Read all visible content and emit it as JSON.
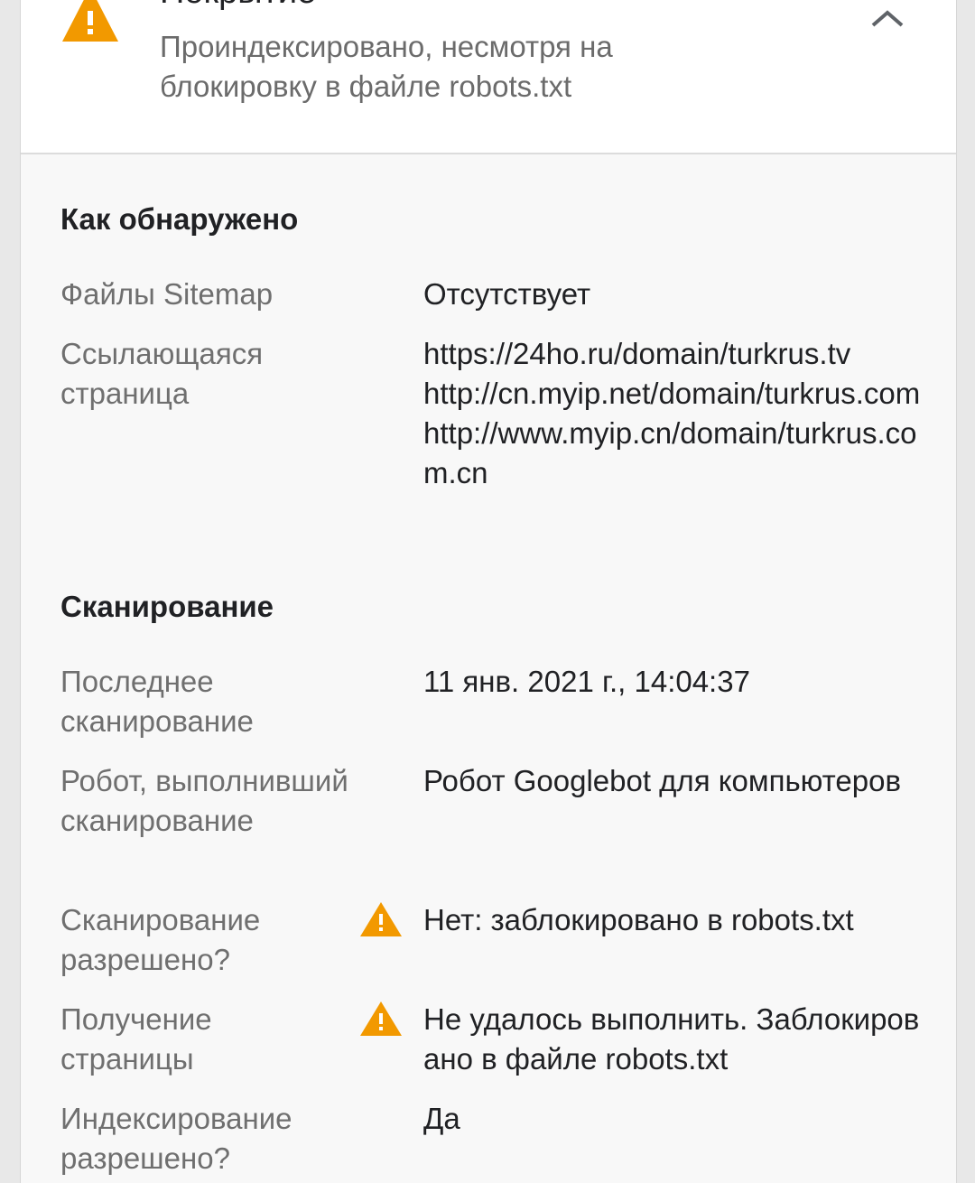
{
  "header": {
    "title": "Покрытие",
    "subtitle": "Проиндексировано, несмотря на блокировку в файле robots.txt",
    "status_icon": "warning-icon",
    "collapse_icon": "chevron-up-icon",
    "warning_color": "#f29900"
  },
  "discovery": {
    "title": "Как обнаружено",
    "rows": [
      {
        "label": "Файлы Sitemap",
        "value": "Отсутствует"
      },
      {
        "label": "Ссылающаяся страница",
        "values": [
          "https://24ho.ru/domain/turkrus.tv",
          "http://cn.myip.net/domain/turkrus.com",
          "http://www.myip.cn/domain/turkrus.com.cn"
        ]
      }
    ]
  },
  "crawl": {
    "title": "Сканирование",
    "rows": [
      {
        "label": "Последнее сканирование",
        "value": "11 янв. 2021 г., 14:04:37"
      },
      {
        "label": "Робот, выполнивший сканирование",
        "value": "Робот Googlebot для компьютеров"
      },
      {
        "label": "Сканирование разрешено?",
        "value": "Нет: заблокировано в robots.txt",
        "warning": true
      },
      {
        "label": "Получение страницы",
        "value": "Не удалось выполнить. Заблокировано в файле robots.txt",
        "warning": true
      },
      {
        "label": "Индексирование разрешено?",
        "value": "Да"
      }
    ]
  }
}
